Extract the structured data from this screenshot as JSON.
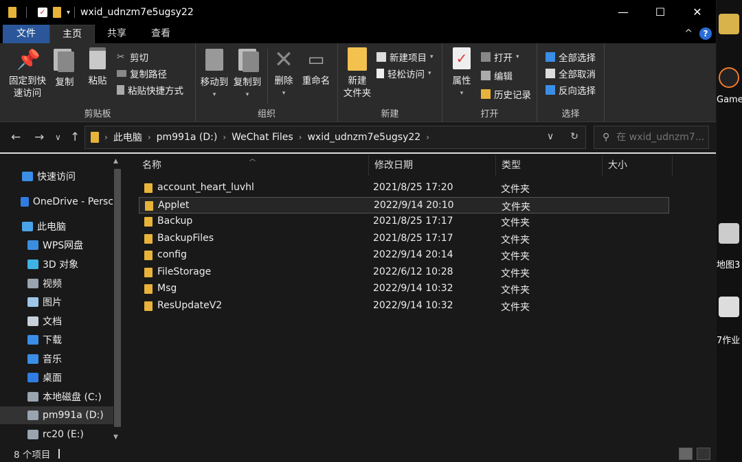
{
  "window": {
    "title": "wxid_udnzm7e5ugsy22",
    "controls": {
      "minimize": "—",
      "maximize": "☐",
      "close": "✕"
    }
  },
  "tabs": {
    "file": "文件",
    "home": "主页",
    "share": "共享",
    "view": "查看"
  },
  "ribbon": {
    "clipboard": {
      "label": "剪贴板",
      "pin_line1": "固定到快",
      "pin_line2": "速访问",
      "copy": "复制",
      "paste": "粘贴",
      "cut": "剪切",
      "copy_path": "复制路径",
      "paste_shortcut": "粘贴快捷方式"
    },
    "organize": {
      "label": "组织",
      "move_to": "移动到",
      "copy_to": "复制到",
      "delete": "删除",
      "rename": "重命名"
    },
    "new": {
      "label": "新建",
      "new_folder_line1": "新建",
      "new_folder_line2": "文件夹",
      "new_item": "新建项目",
      "easy_access": "轻松访问"
    },
    "open": {
      "label": "打开",
      "properties": "属性",
      "open": "打开",
      "edit": "编辑",
      "history": "历史记录"
    },
    "select": {
      "label": "选择",
      "select_all": "全部选择",
      "select_none": "全部取消",
      "invert": "反向选择"
    }
  },
  "address": {
    "crumbs": [
      "此电脑",
      "pm991a (D:)",
      "WeChat Files",
      "wxid_udnzm7e5ugsy22"
    ],
    "search_placeholder": "在 wxid_udnzm7..."
  },
  "nav_pane": [
    {
      "label": "快速访问",
      "icon": "star-icon",
      "color": "#3a8ee6"
    },
    {
      "label": "OneDrive - Persc",
      "icon": "cloud-icon",
      "color": "#2f7de1"
    },
    {
      "label": "此电脑",
      "icon": "computer-icon",
      "color": "#4aa3e8"
    },
    {
      "label": "WPS网盘",
      "icon": "cloud-icon",
      "color": "#3b8de0"
    },
    {
      "label": "3D 对象",
      "icon": "cube-icon",
      "color": "#3fb1e3"
    },
    {
      "label": "视频",
      "icon": "video-icon",
      "color": "#9aa4b0"
    },
    {
      "label": "图片",
      "icon": "image-icon",
      "color": "#9ec6e8"
    },
    {
      "label": "文档",
      "icon": "document-icon",
      "color": "#c8d0da"
    },
    {
      "label": "下载",
      "icon": "download-icon",
      "color": "#3a8ee6"
    },
    {
      "label": "音乐",
      "icon": "music-icon",
      "color": "#3a8ee6"
    },
    {
      "label": "桌面",
      "icon": "desktop-icon",
      "color": "#2f7de1"
    },
    {
      "label": "本地磁盘 (C:)",
      "icon": "drive-icon",
      "color": "#9aa4b0"
    },
    {
      "label": "pm991a (D:)",
      "icon": "drive-icon",
      "color": "#9aa4b0"
    },
    {
      "label": "rc20 (E:)",
      "icon": "drive-icon",
      "color": "#9aa4b0"
    }
  ],
  "columns": {
    "name": "名称",
    "modified": "修改日期",
    "type": "类型",
    "size": "大小"
  },
  "files": [
    {
      "name": "account_heart_luvhl",
      "modified": "2021/8/25 17:20",
      "type": "文件夹"
    },
    {
      "name": "Applet",
      "modified": "2022/9/14 20:10",
      "type": "文件夹"
    },
    {
      "name": "Backup",
      "modified": "2021/8/25 17:17",
      "type": "文件夹"
    },
    {
      "name": "BackupFiles",
      "modified": "2021/8/25 17:17",
      "type": "文件夹"
    },
    {
      "name": "config",
      "modified": "2022/9/14 20:14",
      "type": "文件夹"
    },
    {
      "name": "FileStorage",
      "modified": "2022/6/12 10:28",
      "type": "文件夹"
    },
    {
      "name": "Msg",
      "modified": "2022/9/14 10:32",
      "type": "文件夹"
    },
    {
      "name": "ResUpdateV2",
      "modified": "2022/9/14 10:32",
      "type": "文件夹"
    }
  ],
  "status": {
    "count": "8 个项目"
  },
  "desktop": {
    "game": "Game",
    "map": "地图3",
    "homework": "7作业"
  }
}
